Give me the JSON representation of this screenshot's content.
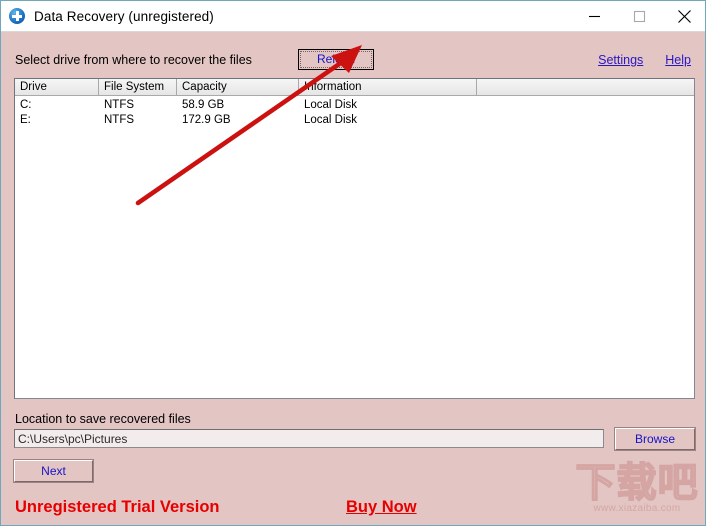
{
  "window": {
    "title": "Data Recovery (unregistered)",
    "app_icon": "blue-circle-plus-icon",
    "controls": {
      "minimize": "minimize-icon",
      "maximize": "maximize-icon",
      "close": "close-icon"
    }
  },
  "toolbar": {
    "prompt": "Select drive from where to recover the files",
    "reload_label": "Reload",
    "settings_label": "Settings",
    "help_label": "Help"
  },
  "drive_list": {
    "columns": [
      "Drive",
      "File System",
      "Capacity",
      "Information",
      ""
    ],
    "rows": [
      {
        "drive": "C:",
        "file_system": "NTFS",
        "capacity": "58.9 GB",
        "information": "Local Disk",
        "extra": ""
      },
      {
        "drive": "E:",
        "file_system": "NTFS",
        "capacity": "172.9 GB",
        "information": "Local Disk",
        "extra": ""
      }
    ]
  },
  "save_location": {
    "label": "Location to save recovered files",
    "path_value": "C:\\Users\\pc\\Pictures",
    "path_placeholder": "C:\\Users\\pc\\Pictures",
    "browse_label": "Browse"
  },
  "actions": {
    "next_label": "Next"
  },
  "footer": {
    "trial_text": "Unregistered Trial Version",
    "buy_now_label": "Buy Now"
  },
  "watermark": {
    "glyphs": "下载吧",
    "url": "www.xiazaiba.com"
  },
  "colors": {
    "window_background": "#e3c5c3",
    "titlebar_background": "#ffffff",
    "link": "#2a17c4",
    "button_text": "#1414c8",
    "trial_red": "#e60000",
    "annotation_arrow": "#cc1111",
    "list_background": "#ffffff"
  },
  "annotation": {
    "arrow_name": "red-pointer-arrow",
    "points_to": "Reload"
  }
}
